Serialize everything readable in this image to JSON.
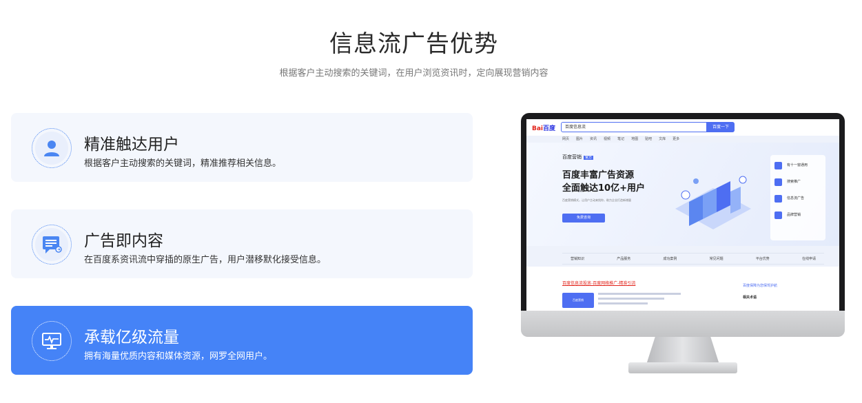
{
  "header": {
    "title": "信息流广告优势",
    "subtitle": "根据客户主动搜索的关键词，在用户浏览资讯时，定向展现营销内容"
  },
  "cards": [
    {
      "icon": "user-icon",
      "title": "精准触达用户",
      "desc": "根据客户主动搜索的关键词，精准推荐相关信息。",
      "active": false
    },
    {
      "icon": "message-icon",
      "title": "广告即内容",
      "desc": "在百度系资讯流中穿插的原生广告，用户潜移默化接受信息。",
      "active": false
    },
    {
      "icon": "monitor-icon",
      "title": "承载亿级流量",
      "desc": "拥有海量优质内容和媒体资源，网罗全网用户。",
      "active": true
    }
  ],
  "screen": {
    "logo_left": "Bai",
    "logo_right": "百度",
    "search_text": "百度信息流",
    "search_button": "百度一下",
    "tabs": [
      "网页",
      "图片",
      "资讯",
      "视频",
      "笔记",
      "地图",
      "贴吧",
      "文库",
      "更多"
    ],
    "brand": "百度营销",
    "brand_badge": "官方",
    "headline_1": "百度丰富广告资源",
    "headline_2": "全面触达10亿+用户",
    "note": "百度营销模式，让用户主动来找你，助力企业打造新增量",
    "cta": "免费咨询",
    "side_items": [
      "有十一窗通用",
      "搜索推广",
      "信息流广告",
      "品牌营销"
    ],
    "nav": [
      "营销知识",
      "产品服务",
      "成功案例",
      "常见问题",
      "平台优势",
      "在线申请"
    ],
    "result_link": "百度信息流投放-百度网络推广-精准引流",
    "thumb_label": "百度营销",
    "right_note": "百度保障为您保驾护航",
    "right_title": "相关术语"
  },
  "colors": {
    "accent": "#4583f7",
    "card_bg": "#f4f7fd"
  }
}
